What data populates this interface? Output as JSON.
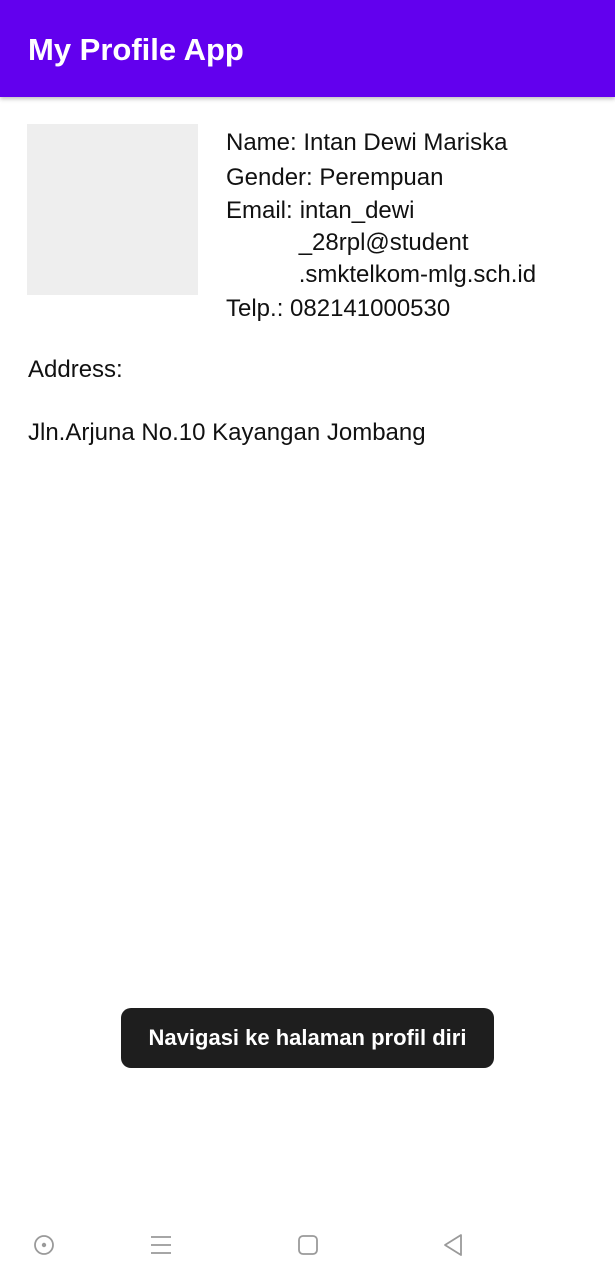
{
  "app": {
    "title": "My Profile App",
    "accent_color": "#6200ee"
  },
  "profile": {
    "photo_icon": "profile-photo-placeholder",
    "name": "Name: Intan Dewi Mariska",
    "gender": "Gender: Perempuan",
    "email_label": "Email:",
    "email_lines": [
      "intan_dewi",
      "_28rpl@student",
      ".smktelkom-mlg.sch.id"
    ],
    "telp": "Telp.: 082141000530",
    "address_label": "Address:",
    "address_value": "Jln.Arjuna No.10 Kayangan Jombang"
  },
  "toast": {
    "message": "Navigasi ke halaman profil diri"
  },
  "nav": {
    "assistant_icon": "assistant-icon",
    "menu_icon": "recent-apps-icon",
    "home_icon": "home-icon",
    "back_icon": "back-icon"
  }
}
